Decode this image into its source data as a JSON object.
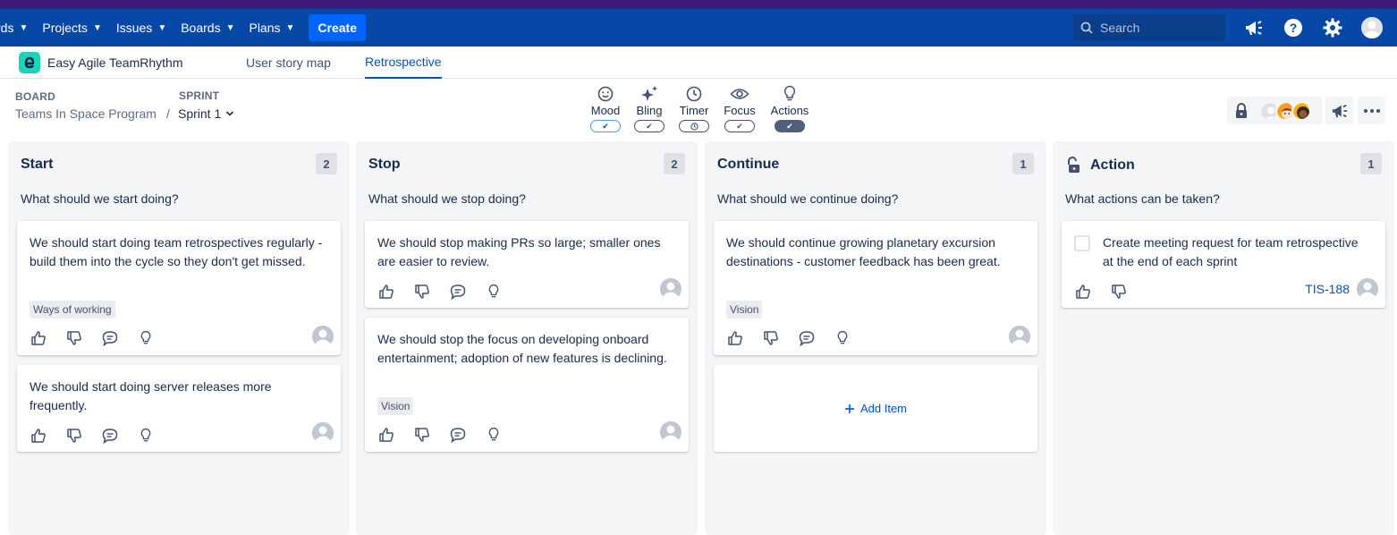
{
  "topnav": {
    "items": [
      {
        "label": "rds"
      },
      {
        "label": "Projects"
      },
      {
        "label": "Issues"
      },
      {
        "label": "Boards"
      },
      {
        "label": "Plans"
      }
    ],
    "create_label": "Create",
    "search_placeholder": "Search"
  },
  "appbar": {
    "app_name": "Easy Agile TeamRhythm",
    "tabs": [
      {
        "label": "User story map",
        "active": false
      },
      {
        "label": "Retrospective",
        "active": true
      }
    ]
  },
  "board_header": {
    "board_label": "BOARD",
    "board_name": "Teams In Space Program",
    "separator": "/",
    "sprint_label": "SPRINT",
    "sprint_name": "Sprint 1"
  },
  "tools": [
    {
      "label": "Mood",
      "icon": "smiley-icon",
      "state": "on-blue"
    },
    {
      "label": "Bling",
      "icon": "sparkle-icon",
      "state": "on"
    },
    {
      "label": "Timer",
      "icon": "clock-icon",
      "state": "timer"
    },
    {
      "label": "Focus",
      "icon": "eye-icon",
      "state": "on"
    },
    {
      "label": "Actions",
      "icon": "lightbulb-icon",
      "state": "active"
    }
  ],
  "columns": [
    {
      "title": "Start",
      "count": "2",
      "question": "What should we start doing?",
      "cards": [
        {
          "text": "We should start doing team retrospectives regularly - build them into the cycle so they don't get missed.",
          "tag": "Ways of working"
        },
        {
          "text": "We should start doing server releases more frequently.",
          "tag": ""
        }
      ]
    },
    {
      "title": "Stop",
      "count": "2",
      "question": "What should we stop doing?",
      "cards": [
        {
          "text": "We should stop making PRs so large; smaller ones are easier to review.",
          "tag": ""
        },
        {
          "text": "We should stop the focus on developing onboard entertainment; adoption of new features is declining.",
          "tag": "Vision"
        }
      ]
    },
    {
      "title": "Continue",
      "count": "1",
      "question": "What should we continue doing?",
      "cards": [
        {
          "text": "We should continue growing planetary excursion destinations - customer feedback has been great.",
          "tag": "Vision"
        }
      ],
      "add_item_label": "Add Item"
    },
    {
      "title": "Action",
      "count": "1",
      "question": "What actions can be taken?",
      "cards": [
        {
          "text": "Create meeting request for team retrospective at the end of each sprint",
          "issue_key": "TIS-188"
        }
      ]
    }
  ],
  "colors": {
    "nav_bg": "#0747a6",
    "top_strip": "#3d1a78",
    "create_btn": "#0065ff",
    "accent": "#0052cc",
    "column_bg": "#f4f5f7"
  }
}
